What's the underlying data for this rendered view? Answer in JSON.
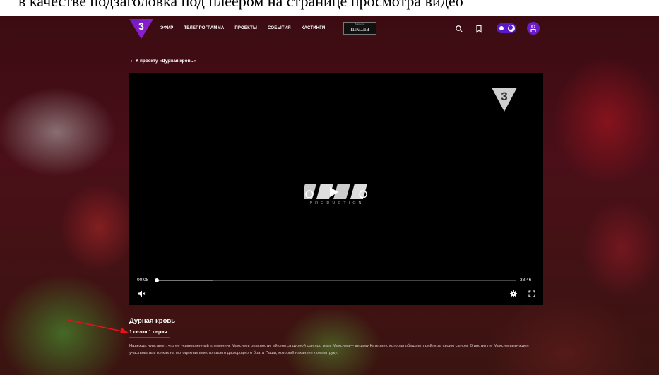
{
  "caption": "в качестве подзаголовка под плеером на странице просмотра видео",
  "header": {
    "logo_text": "3",
    "nav": [
      "ЭФИР",
      "ТЕЛЕПРОГРАММА",
      "ПРОЕКТЫ",
      "СОБЫТИЯ",
      "КАСТИНГИ"
    ],
    "school_badge_small": "Закрытая",
    "school_badge": "школа"
  },
  "back_link": "К проекту «Дурная кровь»",
  "player": {
    "production_text": "PRODUCTION",
    "time_current": "00:08",
    "time_total": "38:46",
    "progress_fraction": 0.004,
    "buffer_fraction": 0.16
  },
  "video": {
    "title": "Дурная кровь",
    "subtitle": "1 сезон 1 серия",
    "description": "Надежда чувствует, что ее усыновленный племянник Максим в опасности: ей снится дурной сон про мать Максима— ведьму Катерину, которая обещает прийти за своим сыном. В институте Максим вынужден участвовать в гонках на мотоциклах вместо своего двоюродного брата Паши, который накануне ломает руку."
  },
  "colors": {
    "accent": "#6a1cc6",
    "annotation": "#e8101a"
  },
  "icons": [
    "search-icon",
    "bookmark-icon",
    "sun-icon",
    "moon-icon",
    "user-icon",
    "volume-icon",
    "settings-icon",
    "fullscreen-icon",
    "chevron-left-icon"
  ]
}
